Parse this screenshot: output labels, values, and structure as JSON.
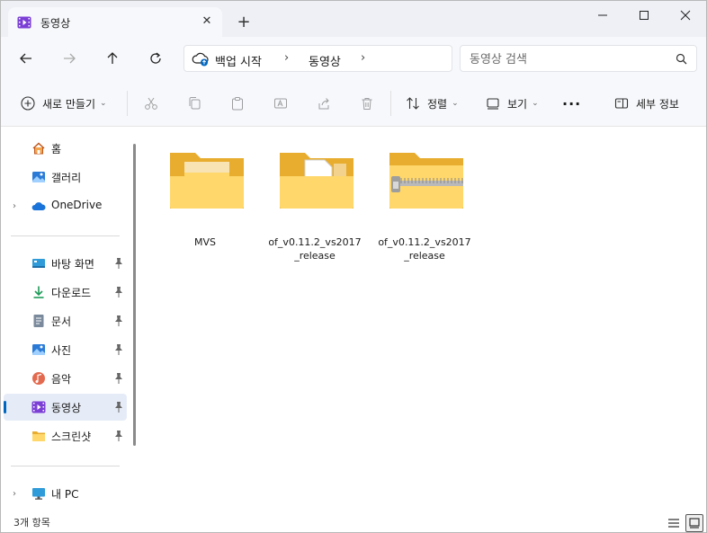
{
  "window": {
    "tab_title": "동영상",
    "new_tab_symbol": "+",
    "close_tab_symbol": "✕"
  },
  "address": {
    "crumbs": [
      "백업 시작",
      "동영상"
    ],
    "search_placeholder": "동영상 검색"
  },
  "commands": {
    "new_label": "새로 만들기",
    "sort_label": "정렬",
    "view_label": "보기",
    "more_label": "···",
    "details_label": "세부 정보"
  },
  "sidebar": {
    "items": [
      {
        "label": "홈",
        "icon": "home-icon"
      },
      {
        "label": "갤러리",
        "icon": "gallery-icon"
      },
      {
        "label": "OneDrive",
        "icon": "onedrive-icon"
      },
      {
        "label": "바탕 화면",
        "icon": "desktop-icon"
      },
      {
        "label": "다운로드",
        "icon": "downloads-icon"
      },
      {
        "label": "문서",
        "icon": "documents-icon"
      },
      {
        "label": "사진",
        "icon": "pictures-icon"
      },
      {
        "label": "음악",
        "icon": "music-icon"
      },
      {
        "label": "동영상",
        "icon": "videos-icon"
      },
      {
        "label": "스크린샷",
        "icon": "folder-icon"
      },
      {
        "label": "내 PC",
        "icon": "this-pc-icon"
      }
    ]
  },
  "files": [
    {
      "name": "MVS",
      "type": "folder"
    },
    {
      "name": "of_v0.11.2_vs2017_release",
      "type": "folder"
    },
    {
      "name": "of_v0.11.2_vs2017_release",
      "type": "zip-folder"
    }
  ],
  "status": {
    "count_text": "3개 항목"
  },
  "colors": {
    "accent": "#0067c0",
    "folder_back": "#e8ac2e",
    "folder_front": "#ffd76a",
    "selected_bg": "#e6ecf7"
  }
}
